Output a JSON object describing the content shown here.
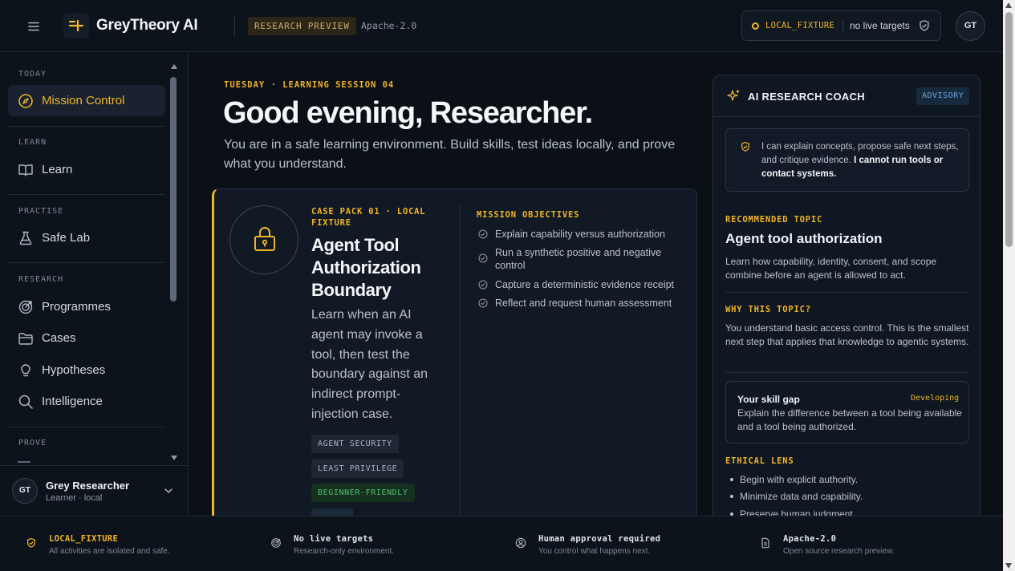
{
  "header": {
    "brand": "GreyTheory AI",
    "preview_badge": "RESEARCH PREVIEW",
    "license": "Apache-2.0",
    "status_code": "LOCAL_FIXTURE",
    "status_text": "no live targets",
    "avatar_initials": "GT"
  },
  "sidebar": {
    "sections": [
      {
        "label": "TODAY",
        "items": [
          {
            "label": "Mission Control",
            "icon": "compass-icon",
            "active": true
          }
        ]
      },
      {
        "label": "LEARN",
        "items": [
          {
            "label": "Learn",
            "icon": "book-icon"
          }
        ]
      },
      {
        "label": "PRACTISE",
        "items": [
          {
            "label": "Safe Lab",
            "icon": "flask-icon"
          }
        ]
      },
      {
        "label": "RESEARCH",
        "items": [
          {
            "label": "Programmes",
            "icon": "target-icon"
          },
          {
            "label": "Cases",
            "icon": "folder-icon"
          },
          {
            "label": "Hypotheses",
            "icon": "lightbulb-icon"
          },
          {
            "label": "Intelligence",
            "icon": "search-icon"
          }
        ]
      },
      {
        "label": "PROVE",
        "items": []
      }
    ],
    "user": {
      "initials": "GT",
      "name": "Grey Researcher",
      "role": "Learner · local"
    }
  },
  "main": {
    "kicker": "TUESDAY · LEARNING SESSION 04",
    "greeting": "Good evening, Researcher.",
    "intro": "You are in a safe learning environment. Build skills, test ideas locally, and prove what you understand.",
    "case": {
      "kicker": "CASE PACK 01 · LOCAL FIXTURE",
      "title": "Agent Tool Authorization Boundary",
      "description": "Learn when an AI agent may invoke a tool, then test the boundary against an indirect prompt-injection case.",
      "tags": [
        "AGENT SECURITY",
        "LEAST PRIVILEGE",
        "BEGINNER-FRIENDLY"
      ],
      "objectives_label": "MISSION OBJECTIVES",
      "objectives": [
        "Explain capability versus authorization",
        "Run a synthetic positive and negative control",
        "Capture a deterministic evidence receipt",
        "Reflect and request human assessment"
      ]
    }
  },
  "coach": {
    "title": "AI RESEARCH COACH",
    "badge": "ADVISORY",
    "note": "I can explain concepts, propose safe next steps, and critique evidence.",
    "note_strong": "I cannot run tools or contact systems.",
    "recommended_label": "RECOMMENDED TOPIC",
    "topic": "Agent tool authorization",
    "topic_text": "Learn how capability, identity, consent, and scope combine before an agent is allowed to act.",
    "why_label": "WHY THIS TOPIC?",
    "why_text": "You understand basic access control. This is the smallest next step that applies that knowledge to agentic systems.",
    "gap_title": "Your skill gap",
    "gap_level": "Developing",
    "gap_text": "Explain the difference between a tool being available and a tool being authorized.",
    "ethical_label": "ETHICAL LENS",
    "ethical_items": [
      "Begin with explicit authority.",
      "Minimize data and capability.",
      "Preserve human judgment."
    ]
  },
  "footer": [
    {
      "title": "LOCAL_FIXTURE",
      "sub": "All activities are isolated and safe.",
      "icon": "shield-icon"
    },
    {
      "title": "No live targets",
      "sub": "Research-only environment.",
      "icon": "target-icon"
    },
    {
      "title": "Human approval required",
      "sub": "You control what happens next.",
      "icon": "user-circle-icon"
    },
    {
      "title": "Apache-2.0",
      "sub": "Open source research preview.",
      "icon": "document-icon"
    }
  ],
  "colors": {
    "accent": "#f0b429",
    "background": "#0b1017",
    "panel": "#111925",
    "success": "#4cc36b",
    "info": "#6ba3d6"
  }
}
